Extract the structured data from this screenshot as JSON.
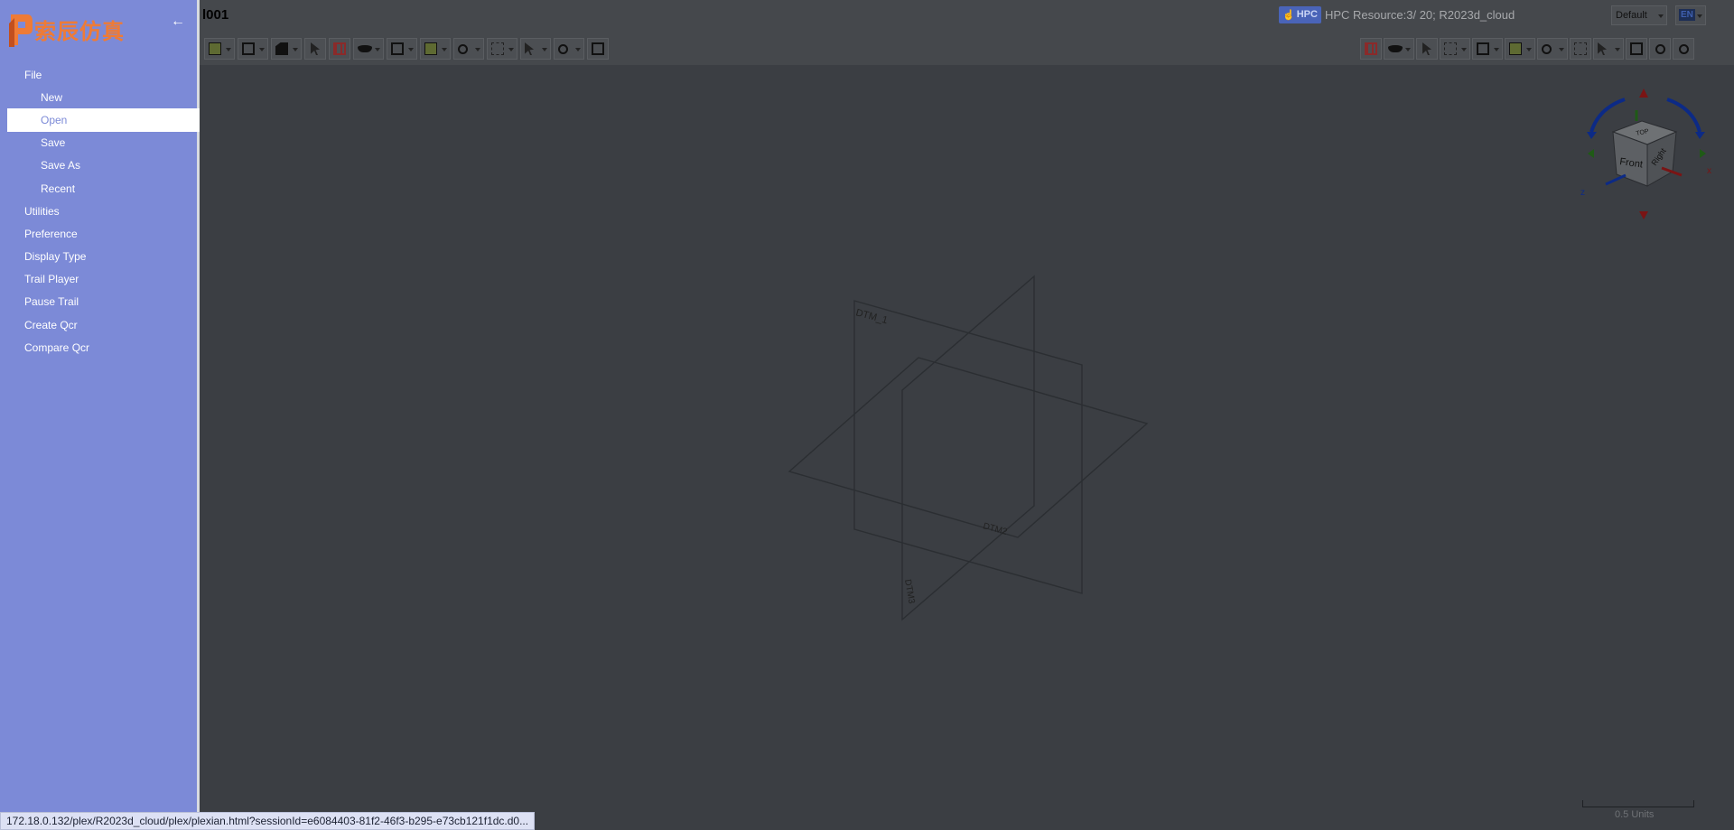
{
  "document": {
    "title": "l001"
  },
  "hpc": {
    "badge": "HPC",
    "resource": "HPC Resource:3/ 20; R2023d_cloud"
  },
  "view": {
    "selected": "Default"
  },
  "language": {
    "selected": "EN"
  },
  "logo": {
    "text": "索辰仿真",
    "color": "#ee7b36"
  },
  "sidebar": {
    "background": "#7c8ad7",
    "items": [
      {
        "label": "File",
        "level": "top"
      },
      {
        "label": "New",
        "level": "sub"
      },
      {
        "label": "Open",
        "level": "sub",
        "active": true
      },
      {
        "label": "Save",
        "level": "sub"
      },
      {
        "label": "Save As",
        "level": "sub"
      },
      {
        "label": "Recent",
        "level": "sub"
      },
      {
        "label": "Utilities",
        "level": "top"
      },
      {
        "label": "Preference",
        "level": "top"
      },
      {
        "label": "Display Type",
        "level": "top"
      },
      {
        "label": "Trail Player",
        "level": "top"
      },
      {
        "label": "Pause Trail",
        "level": "top"
      },
      {
        "label": "Create Qcr",
        "level": "top"
      },
      {
        "label": "Compare Qcr",
        "level": "top"
      }
    ]
  },
  "viewport": {
    "datum_labels": {
      "dtm1": "DTM_1",
      "dtm2": "DTM2",
      "dtm3": "DTM3"
    },
    "view_cube": {
      "top": "TOP",
      "front": "Front",
      "right": "Right",
      "axis_x": "x",
      "axis_z": "z"
    },
    "scale": {
      "label": "0.5  Units"
    }
  },
  "status": {
    "url": "172.18.0.132/plex/R2023d_cloud/plex/plexian.html?sessionId=e6084403-81f2-46f3-b295-e73cb121f1dc.d0..."
  }
}
